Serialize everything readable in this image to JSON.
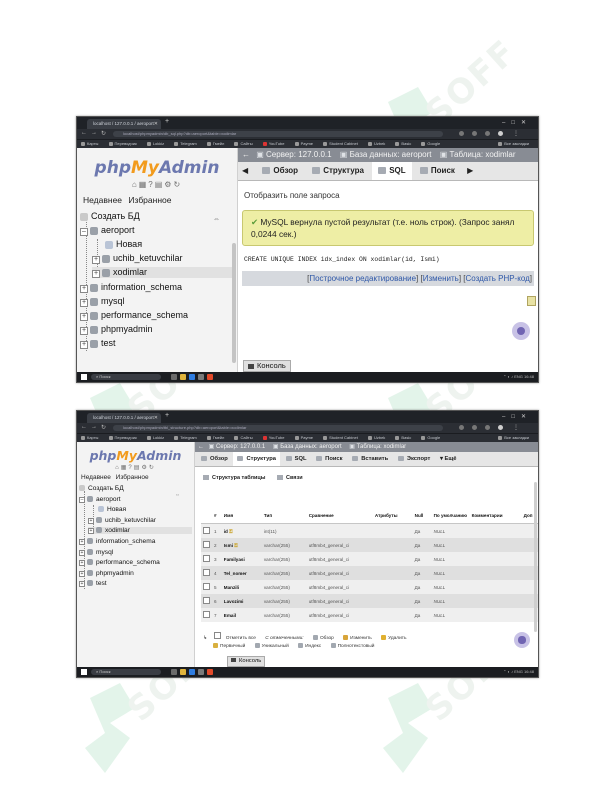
{
  "watermark": {
    "text": "SOFF",
    "color": "#dff3e8"
  },
  "browser": {
    "tab_title": "localhost / 127.0.0.1 / aeroport",
    "url_shot1": "localhost/phpmyadmin/db_sql.php?db=aeroport&table=xodimlar",
    "url_shot2": "localhost/phpmyadmin/tbl_structure.php?db=aeroport&table=xodimlar",
    "bookmarks": [
      "Карты",
      "Переводчик",
      "Lokkiz",
      "Telegram",
      "Гмейл",
      "Сайты",
      "YouTube",
      "Payme",
      "Student Cabinet",
      "Uzbek",
      "Basic",
      "Google",
      "Все закладки"
    ]
  },
  "sidebar": {
    "logo": {
      "php": "php",
      "my": "My",
      "admin": "Admin"
    },
    "recent_label": "Недавнее",
    "favorites_label": "Избранное",
    "tree": {
      "create_db": "Создать БД",
      "aeroport": "aeroport",
      "new": "Новая",
      "uchib_ketuvchilar": "uchib_ketuvchilar",
      "xodimlar": "xodimlar",
      "information_schema": "information_schema",
      "mysql": "mysql",
      "performance_schema": "performance_schema",
      "phpmyadmin": "phpmyadmin",
      "test": "test"
    }
  },
  "breadcrumb": {
    "server": "Сервер: 127.0.0.1",
    "database": "База данных: aeroport",
    "table": "Таблица: xodimlar"
  },
  "menu1": {
    "browse": "Обзор",
    "structure": "Структура",
    "sql": "SQL",
    "search": "Поиск"
  },
  "shot1": {
    "show_query_box": "Отобразить поле запроса",
    "success_message": "MySQL вернула пустой результат (т.е. ноль строк). (Запрос занял 0,0244 сек.)",
    "sql": "CREATE UNIQUE INDEX idx_index ON xodimlar(id, Ismi)",
    "link_inline": "Построчное редактирование",
    "link_edit": "Изменить",
    "link_php": "Создать PHP-код"
  },
  "console_label": "Консоль",
  "menu2": {
    "browse": "Обзор",
    "structure": "Структура",
    "sql": "SQL",
    "search": "Поиск",
    "insert": "Вставить",
    "export": "Экспорт",
    "more": "Ещё"
  },
  "shot2": {
    "subtab_structure": "Структура таблицы",
    "subtab_relations": "Связи",
    "columns": [
      "#",
      "Имя",
      "Тип",
      "Сравнение",
      "Атрибуты",
      "Null",
      "По умолчанию",
      "Комментарии",
      "Доп"
    ],
    "rows": [
      {
        "n": "1",
        "name": "id",
        "type": "int(11)",
        "collation": "",
        "null": "Да",
        "default": "NULL"
      },
      {
        "n": "2",
        "name": "Ismi",
        "type": "varchar(255)",
        "collation": "utf8mb4_general_ci",
        "null": "Да",
        "default": "NULL"
      },
      {
        "n": "3",
        "name": "Familyasi",
        "type": "varchar(255)",
        "collation": "utf8mb4_general_ci",
        "null": "Да",
        "default": "NULL"
      },
      {
        "n": "4",
        "name": "Tel_nomer",
        "type": "varchar(255)",
        "collation": "utf8mb4_general_ci",
        "null": "Да",
        "default": "NULL"
      },
      {
        "n": "5",
        "name": "Manzili",
        "type": "varchar(255)",
        "collation": "utf8mb4_general_ci",
        "null": "Да",
        "default": "NULL"
      },
      {
        "n": "6",
        "name": "Lavozimi",
        "type": "varchar(255)",
        "collation": "utf8mb4_general_ci",
        "null": "Да",
        "default": "NULL"
      },
      {
        "n": "7",
        "name": "Email",
        "type": "varchar(255)",
        "collation": "utf8mb4_general_ci",
        "null": "Да",
        "default": "NULL"
      }
    ],
    "check_all": "Отметить все",
    "with_selected": "С отмеченными:",
    "act_browse": "Обзор",
    "act_change": "Изменить",
    "act_drop": "Удалить",
    "act_primary": "Первичный",
    "act_unique": "Уникальный",
    "act_index": "Индекс",
    "act_fulltext": "Полнотекстовый"
  },
  "taskbar": {
    "search": "Поиск",
    "lang": "ENG",
    "clock": "16:48"
  }
}
